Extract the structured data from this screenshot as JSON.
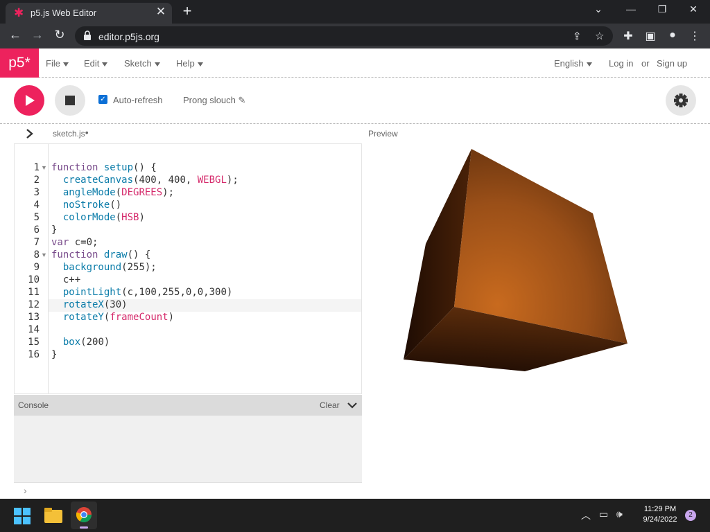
{
  "browser": {
    "tab_title": "p5.js Web Editor",
    "tab_close": "✕",
    "new_tab": "+",
    "url": "editor.p5js.org"
  },
  "p5nav": {
    "logo": "p5*",
    "menus": [
      "File",
      "Edit",
      "Sketch",
      "Help"
    ],
    "language": "English",
    "login": "Log in",
    "or": "or",
    "signup": "Sign up"
  },
  "toolbar": {
    "auto_refresh_label": "Auto-refresh",
    "auto_refresh_checked": true,
    "sketch_name": "Prong slouch"
  },
  "editor": {
    "file_tab": "sketch.js",
    "unsaved": "•",
    "line_numbers": [
      "1",
      "2",
      "3",
      "4",
      "5",
      "6",
      "7",
      "8",
      "9",
      "10",
      "11",
      "12",
      "13",
      "14",
      "15",
      "16"
    ],
    "lines": [
      "function setup() {",
      "  createCanvas(400, 400, WEBGL);",
      "  angleMode(DEGREES);",
      "  noStroke()",
      "  colorMode(HSB)",
      "}",
      "var c=0;",
      "function draw() {",
      "  background(255);",
      "  c++",
      "  pointLight(c,100,255,0,0,300)",
      "  rotateX(30)",
      "  rotateY(frameCount)",
      "",
      "  box(200)",
      "}"
    ],
    "active_line": 12
  },
  "preview": {
    "label": "Preview"
  },
  "console": {
    "label": "Console",
    "clear": "Clear",
    "prompt": "›"
  },
  "taskbar": {
    "time": "11:29 PM",
    "date": "9/24/2022",
    "notifications": "2"
  },
  "colors": {
    "accent": "#ed225d",
    "chrome_dark": "#202124",
    "cube_face": "#a0521a"
  }
}
